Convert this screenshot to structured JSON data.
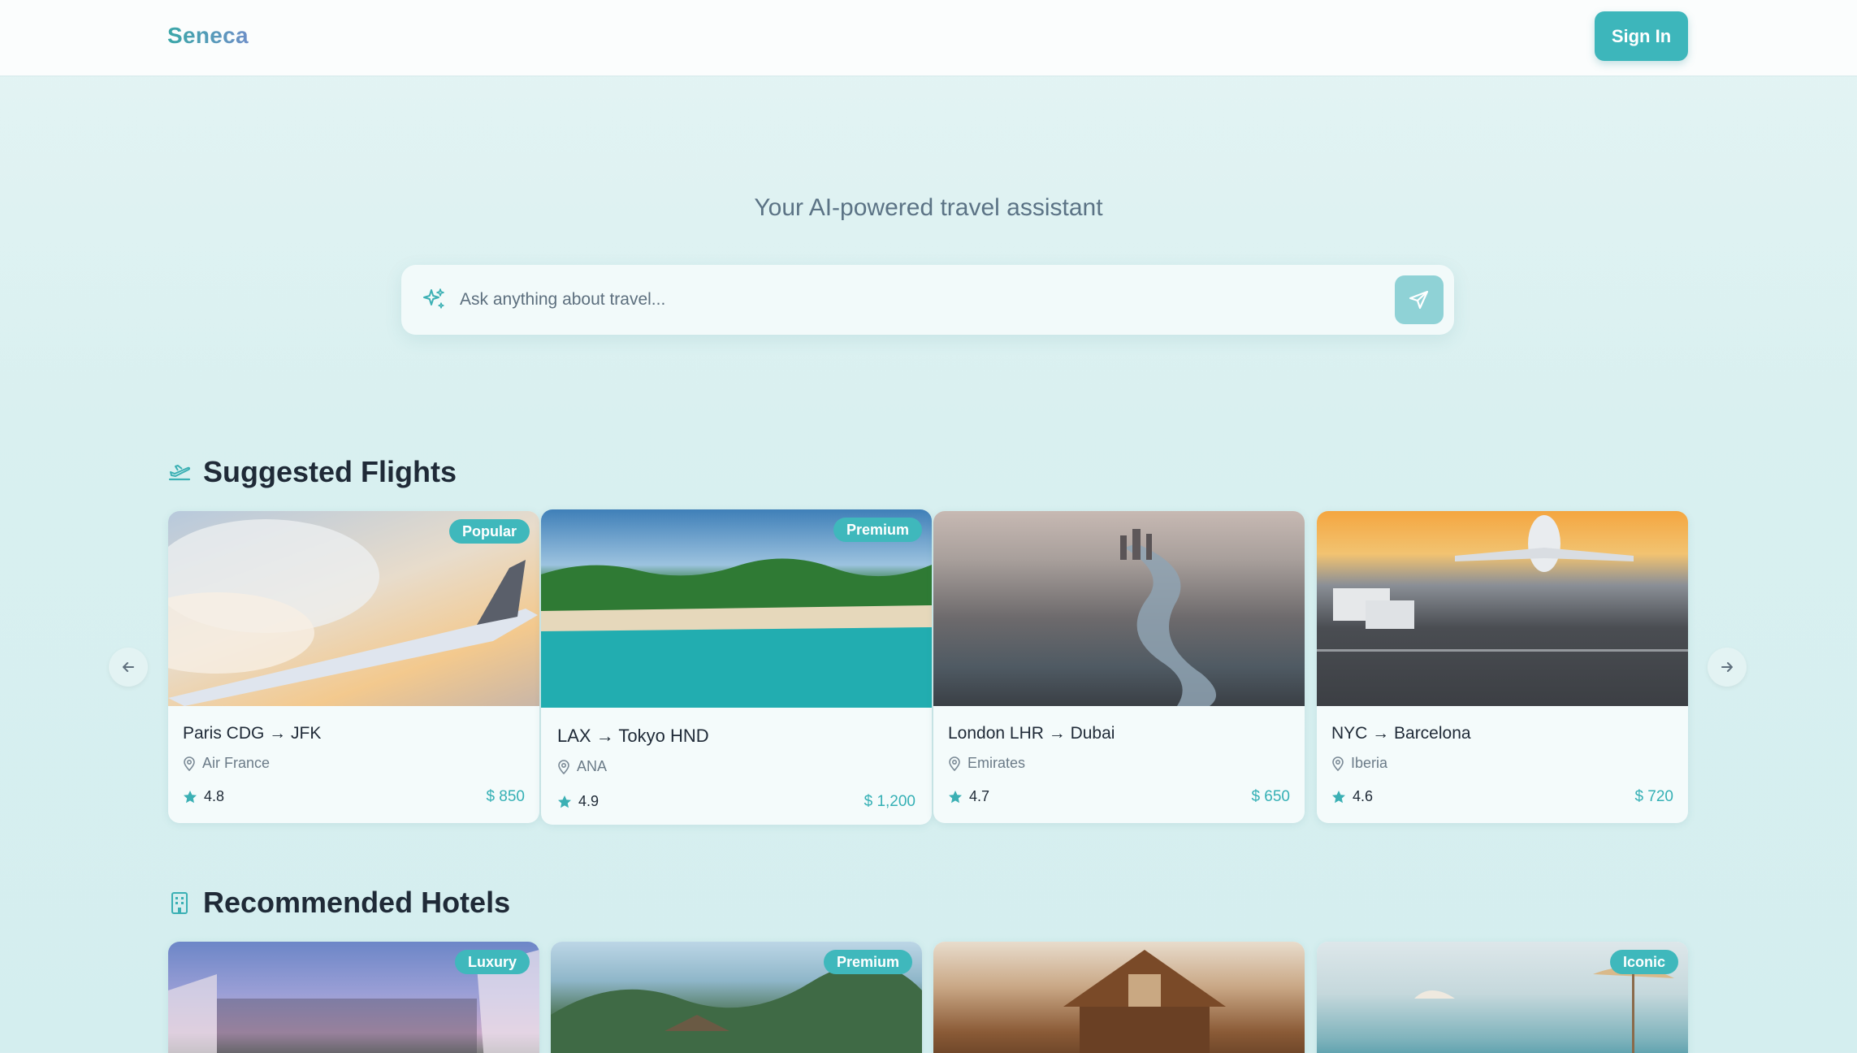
{
  "header": {
    "logo": "Seneca",
    "signin_label": "Sign In"
  },
  "hero": {
    "tagline": "Your AI-powered travel assistant",
    "search_placeholder": "Ask anything about travel..."
  },
  "flights": {
    "title": "Suggested Flights",
    "cards": [
      {
        "badge": "Popular",
        "route": "Paris CDG → JFK",
        "airline": "Air France",
        "rating": "4.8",
        "price": "$ 850"
      },
      {
        "badge": "Premium",
        "route": "LAX → Tokyo HND",
        "airline": "ANA",
        "rating": "4.9",
        "price": "$ 1,200"
      },
      {
        "badge": "",
        "route": "London LHR → Dubai",
        "airline": "Emirates",
        "rating": "4.7",
        "price": "$ 650"
      },
      {
        "badge": "",
        "route": "NYC → Barcelona",
        "airline": "Iberia",
        "rating": "4.6",
        "price": "$ 720"
      }
    ]
  },
  "hotels": {
    "title": "Recommended Hotels",
    "cards": [
      {
        "badge": "Luxury"
      },
      {
        "badge": "Premium"
      },
      {
        "badge": ""
      },
      {
        "badge": "Iconic"
      }
    ]
  },
  "colors": {
    "accent": "#3db6bb",
    "background": "#d9f0f0",
    "text": "#1f2a37"
  },
  "icons": {
    "search": "sparkle-icon",
    "send": "send-icon",
    "flights": "plane-takeoff-icon",
    "hotels": "building-icon",
    "location": "map-pin-icon",
    "rating": "star-icon",
    "prev": "arrow-left-icon",
    "next": "arrow-right-icon"
  }
}
